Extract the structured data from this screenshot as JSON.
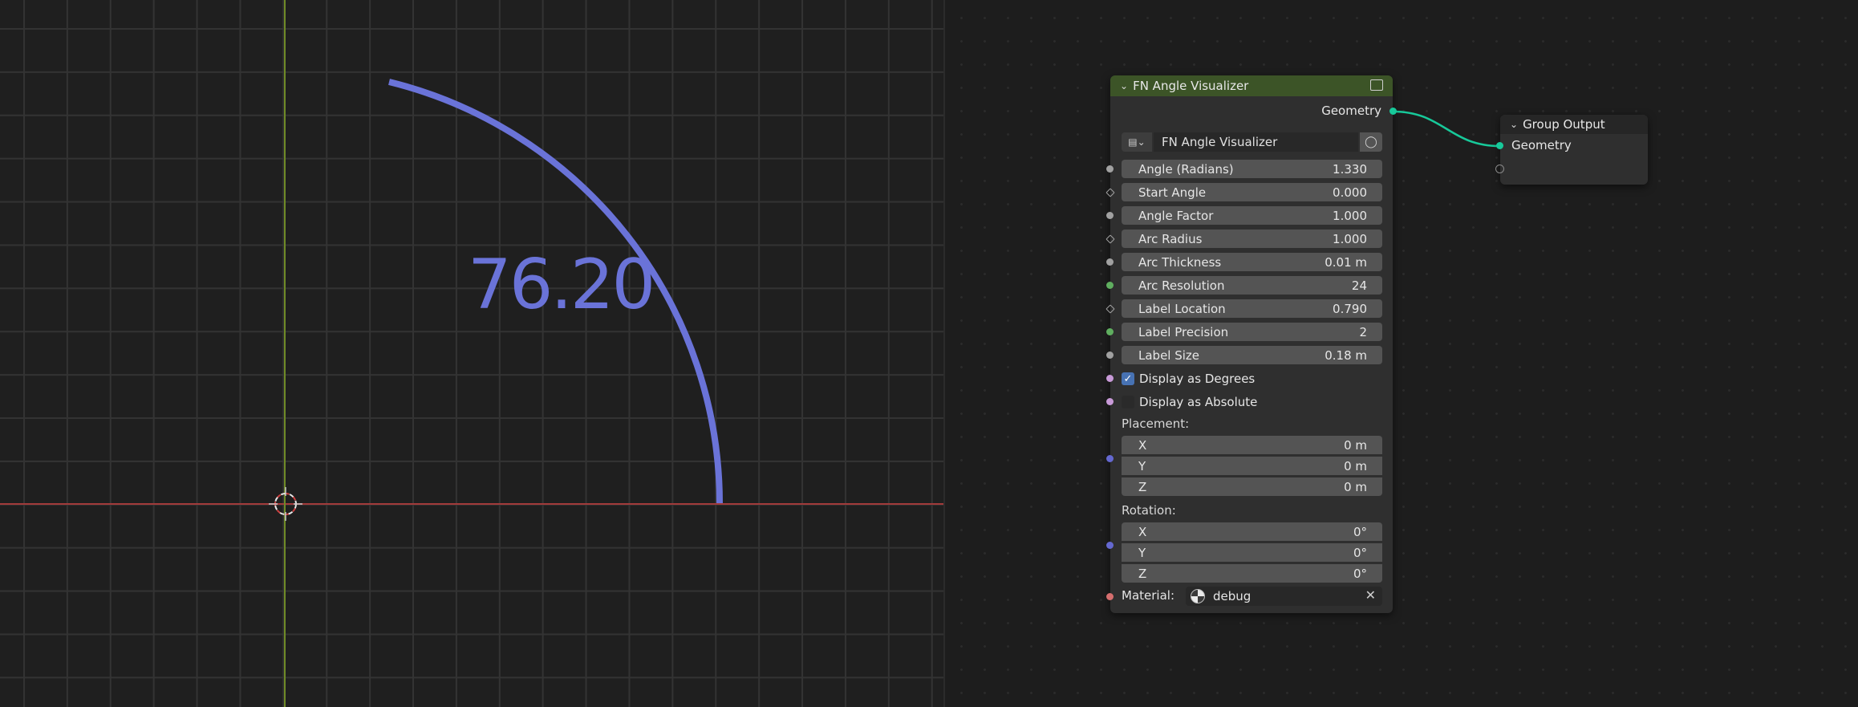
{
  "viewport": {
    "angle_text": "76.20",
    "colors": {
      "arc": "#6a73d8",
      "x_axis": "#a23b3b",
      "y_axis": "#6f8a26"
    },
    "icons": {
      "cursor": "3d-cursor-icon"
    }
  },
  "fn_node": {
    "title": "FN Angle Visualizer",
    "output_label": "Geometry",
    "group_name": "FN Angle Visualizer",
    "inputs": [
      {
        "label": "Angle (Radians)",
        "value": "1.330"
      },
      {
        "label": "Start Angle",
        "value": "0.000"
      },
      {
        "label": "Angle Factor",
        "value": "1.000"
      },
      {
        "label": "Arc Radius",
        "value": "1.000"
      },
      {
        "label": "Arc Thickness",
        "value": "0.01 m"
      },
      {
        "label": "Arc Resolution",
        "value": "24"
      },
      {
        "label": "Label Location",
        "value": "0.790"
      },
      {
        "label": "Label Precision",
        "value": "2"
      },
      {
        "label": "Label Size",
        "value": "0.18 m"
      }
    ],
    "checkboxes": [
      {
        "label": "Display as Degrees",
        "checked": true
      },
      {
        "label": "Display as Absolute",
        "checked": false
      }
    ],
    "placement": {
      "label": "Placement:",
      "x": {
        "label": "X",
        "value": "0 m"
      },
      "y": {
        "label": "Y",
        "value": "0 m"
      },
      "z": {
        "label": "Z",
        "value": "0 m"
      }
    },
    "rotation": {
      "label": "Rotation:",
      "x": {
        "label": "X",
        "value": "0°"
      },
      "y": {
        "label": "Y",
        "value": "0°"
      },
      "z": {
        "label": "Z",
        "value": "0°"
      }
    },
    "material": {
      "label": "Material:",
      "value": "debug"
    },
    "header_color": "#3c5427"
  },
  "group_output": {
    "title": "Group Output",
    "input_label": "Geometry"
  },
  "link_color": "#17c99a"
}
